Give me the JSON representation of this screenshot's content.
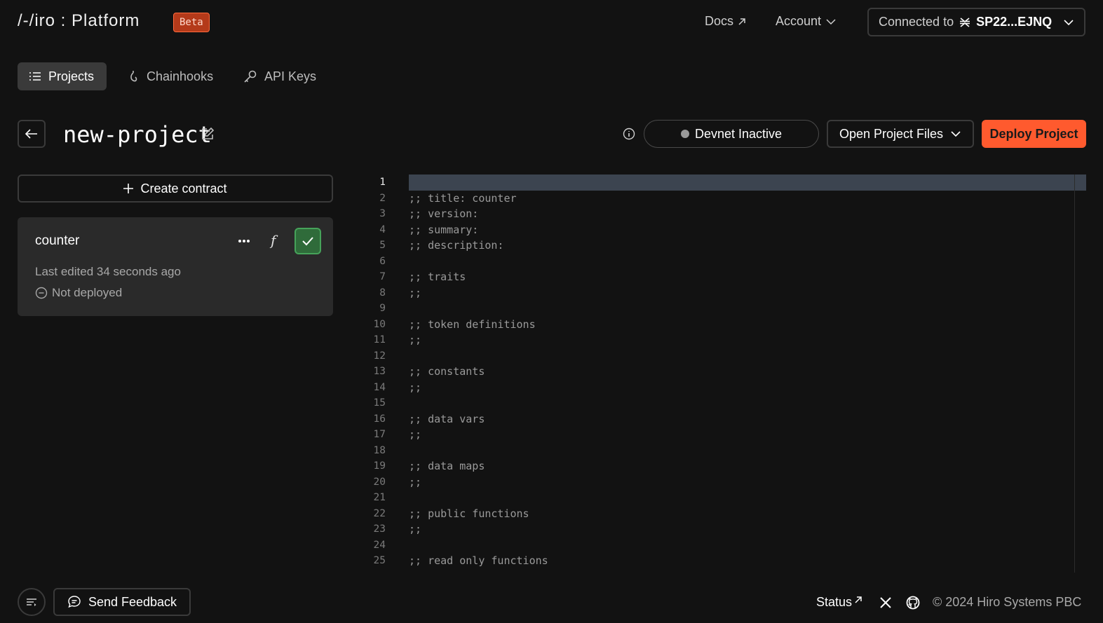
{
  "header": {
    "logo": "/-/iro : Platform",
    "badge": "Beta",
    "docs_label": "Docs",
    "account_label": "Account",
    "connected_label": "Connected to",
    "connected_address": "SP22...EJNQ"
  },
  "tabs": [
    {
      "label": "Projects",
      "icon": "list-icon",
      "active": true
    },
    {
      "label": "Chainhooks",
      "icon": "hook-icon",
      "active": false
    },
    {
      "label": "API Keys",
      "icon": "key-icon",
      "active": false
    }
  ],
  "project": {
    "title": "new-project",
    "devnet_status": "Devnet Inactive",
    "open_files_label": "Open Project Files",
    "deploy_label": "Deploy Project"
  },
  "sidebar": {
    "create_label": "Create contract",
    "contract": {
      "name": "counter",
      "fn_symbol": "f",
      "last_edited": "Last edited 34 seconds ago",
      "deploy_status": "Not deployed"
    }
  },
  "editor": {
    "current_line": 1,
    "lines": [
      "",
      ";; title: counter",
      ";; version:",
      ";; summary:",
      ";; description:",
      "",
      ";; traits",
      ";;",
      "",
      ";; token definitions",
      ";;",
      "",
      ";; constants",
      ";;",
      "",
      ";; data vars",
      ";;",
      "",
      ";; data maps",
      ";;",
      "",
      ";; public functions",
      ";;",
      "",
      ";; read only functions"
    ]
  },
  "footer": {
    "feedback_label": "Send Feedback",
    "status_label": "Status",
    "copyright": "© 2024 Hiro Systems PBC"
  },
  "colors": {
    "accent": "#ff5a2e",
    "background": "#121212",
    "card": "#2a2a2a",
    "success": "#2f6b3a"
  }
}
